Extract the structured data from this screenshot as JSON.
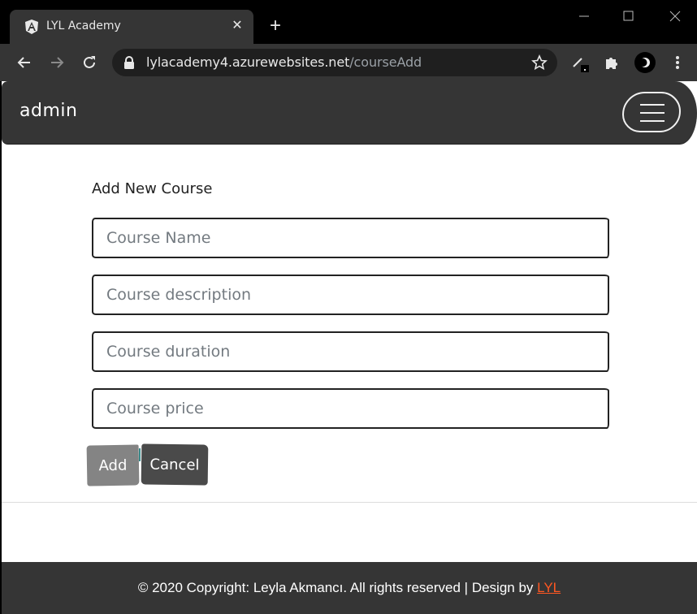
{
  "browser": {
    "tab_title": "LYL Academy",
    "url_domain": "lylacademy4.azurewebsites.net",
    "url_path": "/courseAdd"
  },
  "navbar": {
    "brand": "admin"
  },
  "form": {
    "title": "Add New Course",
    "fields": {
      "name_placeholder": "Course Name",
      "description_placeholder": "Course description",
      "duration_placeholder": "Course duration",
      "price_placeholder": "Course price"
    },
    "add_label": "Add",
    "cancel_label": "Cancel"
  },
  "footer": {
    "text": "© 2020 Copyright: Leyla Akmancı. All rights reserved | Design by ",
    "link": "LYL",
    "link_color": "#ff5722"
  },
  "icons": [
    "angular-icon",
    "close-icon",
    "plus-icon",
    "back-icon",
    "forward-icon",
    "reload-icon",
    "lock-icon",
    "star-icon",
    "pen-icon",
    "puzzle-icon",
    "profile-icon",
    "menu-icon",
    "hamburger-icon"
  ]
}
